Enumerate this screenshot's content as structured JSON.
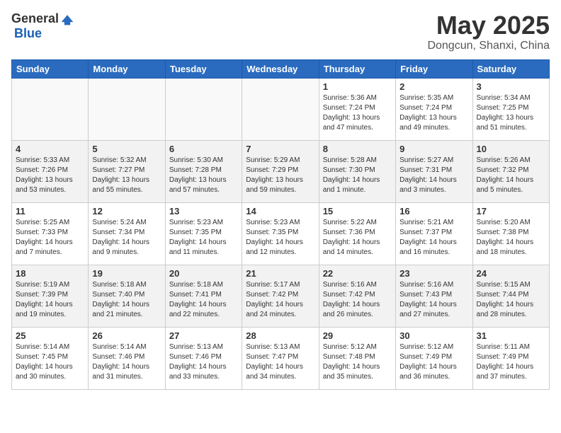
{
  "header": {
    "logo_general": "General",
    "logo_blue": "Blue",
    "month_title": "May 2025",
    "location": "Dongcun, Shanxi, China"
  },
  "weekdays": [
    "Sunday",
    "Monday",
    "Tuesday",
    "Wednesday",
    "Thursday",
    "Friday",
    "Saturday"
  ],
  "weeks": [
    [
      {
        "day": "",
        "info": ""
      },
      {
        "day": "",
        "info": ""
      },
      {
        "day": "",
        "info": ""
      },
      {
        "day": "",
        "info": ""
      },
      {
        "day": "1",
        "info": "Sunrise: 5:36 AM\nSunset: 7:24 PM\nDaylight: 13 hours\nand 47 minutes."
      },
      {
        "day": "2",
        "info": "Sunrise: 5:35 AM\nSunset: 7:24 PM\nDaylight: 13 hours\nand 49 minutes."
      },
      {
        "day": "3",
        "info": "Sunrise: 5:34 AM\nSunset: 7:25 PM\nDaylight: 13 hours\nand 51 minutes."
      }
    ],
    [
      {
        "day": "4",
        "info": "Sunrise: 5:33 AM\nSunset: 7:26 PM\nDaylight: 13 hours\nand 53 minutes."
      },
      {
        "day": "5",
        "info": "Sunrise: 5:32 AM\nSunset: 7:27 PM\nDaylight: 13 hours\nand 55 minutes."
      },
      {
        "day": "6",
        "info": "Sunrise: 5:30 AM\nSunset: 7:28 PM\nDaylight: 13 hours\nand 57 minutes."
      },
      {
        "day": "7",
        "info": "Sunrise: 5:29 AM\nSunset: 7:29 PM\nDaylight: 13 hours\nand 59 minutes."
      },
      {
        "day": "8",
        "info": "Sunrise: 5:28 AM\nSunset: 7:30 PM\nDaylight: 14 hours\nand 1 minute."
      },
      {
        "day": "9",
        "info": "Sunrise: 5:27 AM\nSunset: 7:31 PM\nDaylight: 14 hours\nand 3 minutes."
      },
      {
        "day": "10",
        "info": "Sunrise: 5:26 AM\nSunset: 7:32 PM\nDaylight: 14 hours\nand 5 minutes."
      }
    ],
    [
      {
        "day": "11",
        "info": "Sunrise: 5:25 AM\nSunset: 7:33 PM\nDaylight: 14 hours\nand 7 minutes."
      },
      {
        "day": "12",
        "info": "Sunrise: 5:24 AM\nSunset: 7:34 PM\nDaylight: 14 hours\nand 9 minutes."
      },
      {
        "day": "13",
        "info": "Sunrise: 5:23 AM\nSunset: 7:35 PM\nDaylight: 14 hours\nand 11 minutes."
      },
      {
        "day": "14",
        "info": "Sunrise: 5:23 AM\nSunset: 7:35 PM\nDaylight: 14 hours\nand 12 minutes."
      },
      {
        "day": "15",
        "info": "Sunrise: 5:22 AM\nSunset: 7:36 PM\nDaylight: 14 hours\nand 14 minutes."
      },
      {
        "day": "16",
        "info": "Sunrise: 5:21 AM\nSunset: 7:37 PM\nDaylight: 14 hours\nand 16 minutes."
      },
      {
        "day": "17",
        "info": "Sunrise: 5:20 AM\nSunset: 7:38 PM\nDaylight: 14 hours\nand 18 minutes."
      }
    ],
    [
      {
        "day": "18",
        "info": "Sunrise: 5:19 AM\nSunset: 7:39 PM\nDaylight: 14 hours\nand 19 minutes."
      },
      {
        "day": "19",
        "info": "Sunrise: 5:18 AM\nSunset: 7:40 PM\nDaylight: 14 hours\nand 21 minutes."
      },
      {
        "day": "20",
        "info": "Sunrise: 5:18 AM\nSunset: 7:41 PM\nDaylight: 14 hours\nand 22 minutes."
      },
      {
        "day": "21",
        "info": "Sunrise: 5:17 AM\nSunset: 7:42 PM\nDaylight: 14 hours\nand 24 minutes."
      },
      {
        "day": "22",
        "info": "Sunrise: 5:16 AM\nSunset: 7:42 PM\nDaylight: 14 hours\nand 26 minutes."
      },
      {
        "day": "23",
        "info": "Sunrise: 5:16 AM\nSunset: 7:43 PM\nDaylight: 14 hours\nand 27 minutes."
      },
      {
        "day": "24",
        "info": "Sunrise: 5:15 AM\nSunset: 7:44 PM\nDaylight: 14 hours\nand 28 minutes."
      }
    ],
    [
      {
        "day": "25",
        "info": "Sunrise: 5:14 AM\nSunset: 7:45 PM\nDaylight: 14 hours\nand 30 minutes."
      },
      {
        "day": "26",
        "info": "Sunrise: 5:14 AM\nSunset: 7:46 PM\nDaylight: 14 hours\nand 31 minutes."
      },
      {
        "day": "27",
        "info": "Sunrise: 5:13 AM\nSunset: 7:46 PM\nDaylight: 14 hours\nand 33 minutes."
      },
      {
        "day": "28",
        "info": "Sunrise: 5:13 AM\nSunset: 7:47 PM\nDaylight: 14 hours\nand 34 minutes."
      },
      {
        "day": "29",
        "info": "Sunrise: 5:12 AM\nSunset: 7:48 PM\nDaylight: 14 hours\nand 35 minutes."
      },
      {
        "day": "30",
        "info": "Sunrise: 5:12 AM\nSunset: 7:49 PM\nDaylight: 14 hours\nand 36 minutes."
      },
      {
        "day": "31",
        "info": "Sunrise: 5:11 AM\nSunset: 7:49 PM\nDaylight: 14 hours\nand 37 minutes."
      }
    ]
  ]
}
